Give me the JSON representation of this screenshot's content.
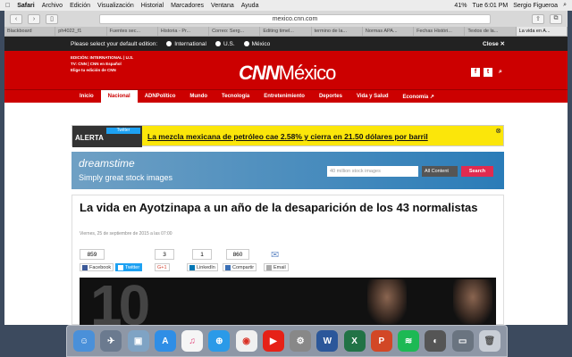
{
  "menubar": {
    "apple": "",
    "items": [
      "Safari",
      "Archivo",
      "Edición",
      "Visualización",
      "Historial",
      "Marcadores",
      "Ventana",
      "Ayuda"
    ],
    "battery": "41%",
    "clock": "Tue 6:01 PM",
    "user": "Sergio Figueroa"
  },
  "browser": {
    "url": "mexico.cnn.com",
    "tabs": [
      "Blackboard",
      "ph4022_f1",
      "Fuentes sec...",
      "Historia - Pr...",
      "Correo: Serg...",
      "Editing timel...",
      "termino de la...",
      "Normas APA...",
      "Fechas Históri...",
      "Textos de la...",
      "La vida en A..."
    ]
  },
  "edition_bar": {
    "prompt": "Please select your default edition:",
    "options": [
      "International",
      "U.S.",
      "México"
    ],
    "close": "Close ✕"
  },
  "header": {
    "edition_line": "EDICIÓN: INTERNATIONAL | U.S.",
    "tv_line": "TV: CNN | CNN en Español",
    "choose_line": "Elige tu edición de CNN",
    "logo_cnn": "CNN",
    "logo_country": "México"
  },
  "nav": [
    "Inicio",
    "Nacional",
    "ADNPolítico",
    "Mundo",
    "Tecnología",
    "Entretenimiento",
    "Deportes",
    "Vida y Salud",
    "Economía ↗"
  ],
  "alert": {
    "label": "ALERTA",
    "twitter": "Twitter",
    "text": "La mezcla mexicana de petróleo cae 2.58% y cierra en 21.50 dólares por barril"
  },
  "ad": {
    "brand": "dreamstime",
    "tagline": "Simply great stock images",
    "search_placeholder": "40 million stock images",
    "category": "All Content",
    "button": "Search"
  },
  "article": {
    "title": "La vida en Ayotzinapa a un año de la desaparición de los 43 normalistas",
    "date": "Viernes, 25 de septiembre de 2015 a las 07:00",
    "shares": [
      {
        "count": "859",
        "label": "Facebook"
      },
      {
        "count": "",
        "label": "Twitter"
      },
      {
        "count": "3",
        "label": "G+1"
      },
      {
        "count": "1",
        "label": "LinkedIn"
      },
      {
        "count": "860",
        "label": "Compartir"
      },
      {
        "count": "",
        "label": "Email"
      }
    ],
    "photo_number": "10"
  },
  "dock": [
    "Finder",
    "Launchpad",
    "Preview",
    "App Store",
    "iTunes",
    "Safari",
    "Chrome",
    "YouTube",
    "System Preferences",
    "Word",
    "Excel",
    "PowerPoint",
    "Spotify",
    "Photo",
    "Display",
    "Trash"
  ]
}
